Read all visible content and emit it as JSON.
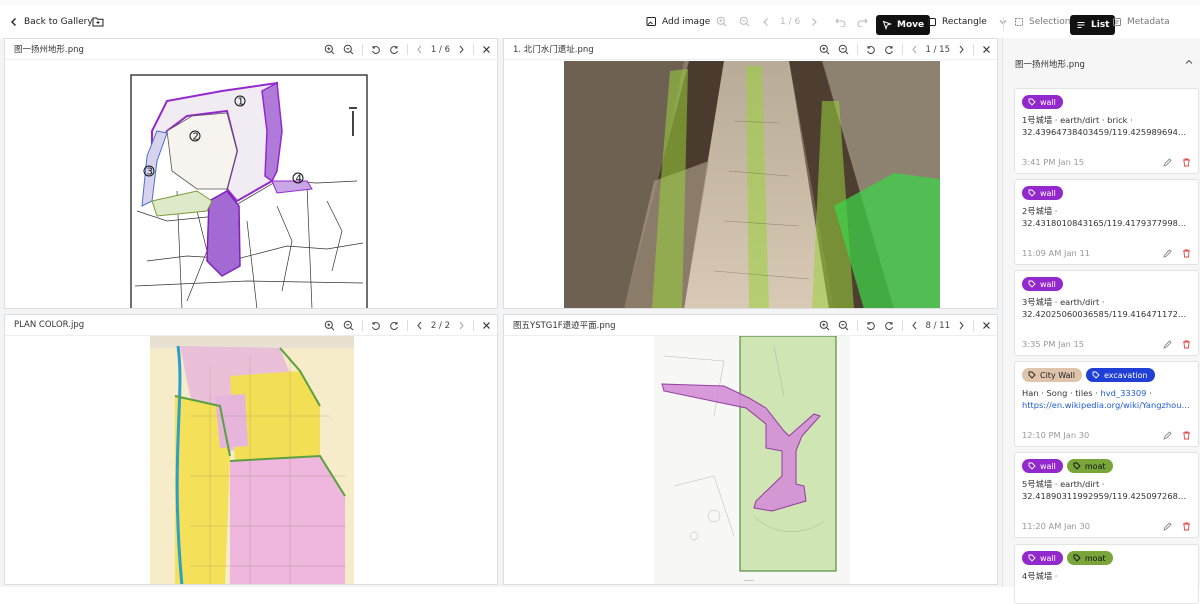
{
  "toolbar": {
    "back_label": "Back to Gallery",
    "add_image_label": "Add image",
    "page_indicator": "1 / 6",
    "move_label": "Move",
    "rectangle_label": "Rectangle",
    "selection_label": "Selection",
    "list_label": "List",
    "metadata_label": "Metadata"
  },
  "panels": [
    {
      "title": "图一扬州地形.png",
      "pager": "1 / 6"
    },
    {
      "title": "1. 北门水门遗址.png",
      "pager": "1 / 15"
    },
    {
      "title": "PLAN COLOR.jpg",
      "pager": "2 / 2"
    },
    {
      "title": "图五YSTG1F遗迹平面.png",
      "pager": "8 / 11"
    }
  ],
  "sidebar": {
    "header": "图一扬州地形.png",
    "cards": [
      {
        "tags": [
          "wall"
        ],
        "line1": "1号城墙 · earth/dirt · brick ·",
        "line2": "32.43964738403459/119.425989694333...",
        "time": "3:41 PM Jan 15"
      },
      {
        "tags": [
          "wall"
        ],
        "line1": "2号城墙 ·",
        "line2": "32.4318010843165/119.41793779985179 · ...",
        "time": "11:09 AM Jan 11"
      },
      {
        "tags": [
          "wall"
        ],
        "line1": "3号城墙 · earth/dirt ·",
        "line2": "32.42025060036585/119.4164711729290...",
        "time": "3:35 PM Jan 15"
      },
      {
        "tags": [
          "City Wall",
          "excavation"
        ],
        "line1_a": "Han · Song · tiles · ",
        "line1_link": "hvd_33309",
        "line1_b": " ·",
        "line2": "https://en.wikipedia.org/wiki/Yangzhou · ...",
        "time": "12:10 PM Jan 30"
      },
      {
        "tags": [
          "wall",
          "moat"
        ],
        "line1": "5号城墙 · earth/dirt ·",
        "line2": "32.41890311992959/119.4250972685344...",
        "time": "11:20 AM Jan 30"
      },
      {
        "tags": [
          "wall",
          "moat"
        ],
        "line1": "4号城墙 ·",
        "line2": "",
        "time": ""
      }
    ]
  },
  "colors": {
    "wall": "#9329cc",
    "moat": "#79a53a",
    "city_wall": "#dfc3ab",
    "excavation": "#1f3fd6"
  }
}
